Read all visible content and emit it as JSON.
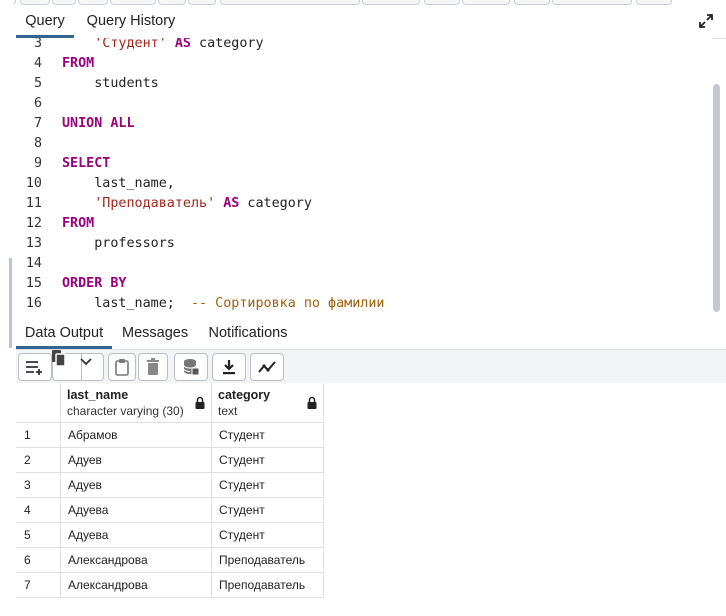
{
  "query_tabs": [
    {
      "label": "Query",
      "active": true
    },
    {
      "label": "Query History",
      "active": false
    }
  ],
  "editor": {
    "lines": [
      {
        "num": "3",
        "tokens": [
          {
            "t": "    ",
            "c": "plain"
          },
          {
            "t": "'Студент'",
            "c": "str"
          },
          {
            "t": " ",
            "c": "plain"
          },
          {
            "t": "AS",
            "c": "kw"
          },
          {
            "t": " category",
            "c": "plain"
          }
        ]
      },
      {
        "num": "4",
        "tokens": [
          {
            "t": "FROM",
            "c": "kw"
          }
        ]
      },
      {
        "num": "5",
        "tokens": [
          {
            "t": "    students",
            "c": "plain"
          }
        ]
      },
      {
        "num": "6",
        "tokens": []
      },
      {
        "num": "7",
        "tokens": [
          {
            "t": "UNION ALL",
            "c": "kw"
          }
        ]
      },
      {
        "num": "8",
        "tokens": []
      },
      {
        "num": "9",
        "tokens": [
          {
            "t": "SELECT",
            "c": "kw"
          }
        ]
      },
      {
        "num": "10",
        "tokens": [
          {
            "t": "    last_name,",
            "c": "plain"
          }
        ]
      },
      {
        "num": "11",
        "tokens": [
          {
            "t": "    ",
            "c": "plain"
          },
          {
            "t": "'Преподаватель'",
            "c": "str"
          },
          {
            "t": " ",
            "c": "plain"
          },
          {
            "t": "AS",
            "c": "kw"
          },
          {
            "t": " category",
            "c": "plain"
          }
        ]
      },
      {
        "num": "12",
        "tokens": [
          {
            "t": "FROM",
            "c": "kw"
          }
        ]
      },
      {
        "num": "13",
        "tokens": [
          {
            "t": "    professors",
            "c": "plain"
          }
        ]
      },
      {
        "num": "14",
        "tokens": []
      },
      {
        "num": "15",
        "tokens": [
          {
            "t": "ORDER BY",
            "c": "kw"
          }
        ]
      },
      {
        "num": "16",
        "tokens": [
          {
            "t": "    last_name;  ",
            "c": "plain"
          },
          {
            "t": "-- Сортировка по фамилии",
            "c": "cmt"
          }
        ]
      }
    ]
  },
  "output_tabs": [
    {
      "label": "Data Output",
      "active": true
    },
    {
      "label": "Messages",
      "active": false
    },
    {
      "label": "Notifications",
      "active": false
    }
  ],
  "output_toolbar": {
    "buttons": [
      {
        "name": "add-row-button",
        "icon": "add-row-icon"
      },
      {
        "name": "copy-button",
        "icon": "copy-icon"
      },
      {
        "name": "copy-options-dropdown",
        "icon": "chevron-down-icon"
      },
      {
        "name": "paste-button",
        "icon": "clipboard-icon"
      },
      {
        "name": "delete-button",
        "icon": "trash-icon"
      },
      {
        "name": "save-data-button",
        "icon": "database-save-icon"
      },
      {
        "name": "download-button",
        "icon": "download-icon"
      },
      {
        "name": "graph-visualiser-button",
        "icon": "line-chart-icon"
      }
    ]
  },
  "grid": {
    "columns": [
      {
        "name": "last_name",
        "type": "character varying (30)",
        "locked": true
      },
      {
        "name": "category",
        "type": "text",
        "locked": true
      }
    ],
    "rows": [
      {
        "num": "1",
        "last_name": "Абрамов",
        "category": "Студент"
      },
      {
        "num": "2",
        "last_name": "Адуев",
        "category": "Студент"
      },
      {
        "num": "3",
        "last_name": "Адуев",
        "category": "Студент"
      },
      {
        "num": "4",
        "last_name": "Адуева",
        "category": "Студент"
      },
      {
        "num": "5",
        "last_name": "Адуева",
        "category": "Студент"
      },
      {
        "num": "6",
        "last_name": "Александрова",
        "category": "Преподаватель"
      },
      {
        "num": "7",
        "last_name": "Александрова",
        "category": "Преподаватель"
      }
    ]
  },
  "colors": {
    "keyword": "#9b007e",
    "string": "#a3251c",
    "comment": "#a0600c",
    "active_tab": "#326690"
  }
}
